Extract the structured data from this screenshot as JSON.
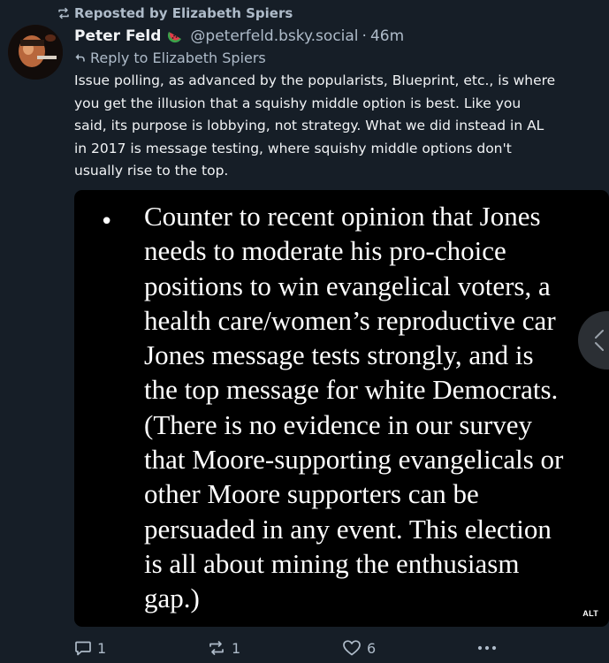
{
  "repost": {
    "icon": "repost-icon",
    "label": "Reposted by Elizabeth Spiers"
  },
  "author": {
    "display_name": "Peter Feld",
    "badge_icon": "watermelon-icon",
    "handle": "@peterfeld.bsky.social",
    "separator": "·",
    "time_ago": "46m"
  },
  "reply": {
    "icon": "reply-arrow-icon",
    "label": "Reply to Elizabeth Spiers"
  },
  "post": {
    "text": "Issue polling, as advanced by the popularists, Blueprint, etc., is where\nyou get the illusion that a squishy middle option is best. Like you\nsaid, its purpose is lobbying, not strategy. What we did instead in AL\nin 2017 is message testing, where squishy middle options don't\nusually rise to the top."
  },
  "image": {
    "bullet": "•",
    "text": "Counter to recent opinion that Jones\nneeds to moderate his pro-choice\npositions to win evangelical voters, a\nhealth care/women’s reproductive car\nJones message tests strongly, and is\nthe top message for white Democrats.\n(There is no evidence in our survey\nthat Moore-supporting evangelicals or\nother Moore supporters can be\npersuaded in any event. This election\nis all about mining the enthusiasm\ngap.)",
    "alt_badge": "ALT",
    "nav_icon": "chevron-up-icon"
  },
  "actions": {
    "reply_count": "1",
    "repost_count": "1",
    "like_count": "6",
    "more_icon": "ellipsis-icon"
  },
  "colors": {
    "background": "#161e27",
    "text": "#f1f3f5",
    "muted": "#aebbc9"
  }
}
